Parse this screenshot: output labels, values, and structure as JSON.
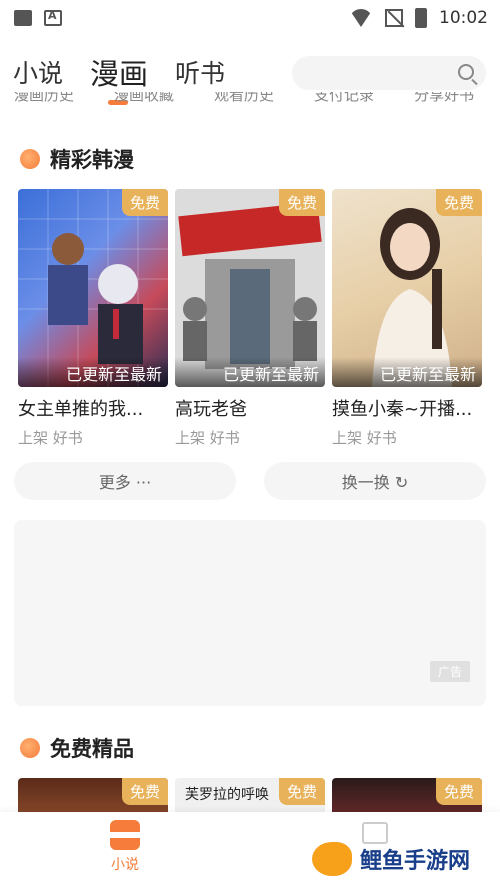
{
  "status": {
    "time": "10:02"
  },
  "tabs": [
    {
      "label": "小说"
    },
    {
      "label": "漫画"
    },
    {
      "label": "听书"
    }
  ],
  "subnav": [
    "漫画历史",
    "漫画收藏",
    "观看历史",
    "支付记录",
    "分享好书"
  ],
  "section1": {
    "title": "精彩韩漫",
    "cards": [
      {
        "title": "女主单推的我...",
        "meta": "上架 好书",
        "badge": "免费",
        "update": "已更新至最新"
      },
      {
        "title": "高玩老爸",
        "meta": "上架 好书",
        "badge": "免费",
        "update": "已更新至最新"
      },
      {
        "title": "摸鱼小秦~开播...",
        "meta": "上架 好书",
        "badge": "免费",
        "update": "已更新至最新"
      }
    ],
    "more_label": "更多 ···",
    "refresh_label": "换一换 ↻"
  },
  "ad": {
    "label": "广告"
  },
  "section2": {
    "title": "免费精品",
    "cards": [
      {
        "badge": "免费"
      },
      {
        "badge": "免费",
        "cover_text": "芙罗拉的呼唤"
      },
      {
        "badge": "免费"
      }
    ]
  },
  "bottom_nav": {
    "novel_label": "小说"
  },
  "watermark": {
    "text": "鲤鱼手游网"
  },
  "colors": {
    "accent": "#f57c3a",
    "badge": "#e8b25a"
  }
}
